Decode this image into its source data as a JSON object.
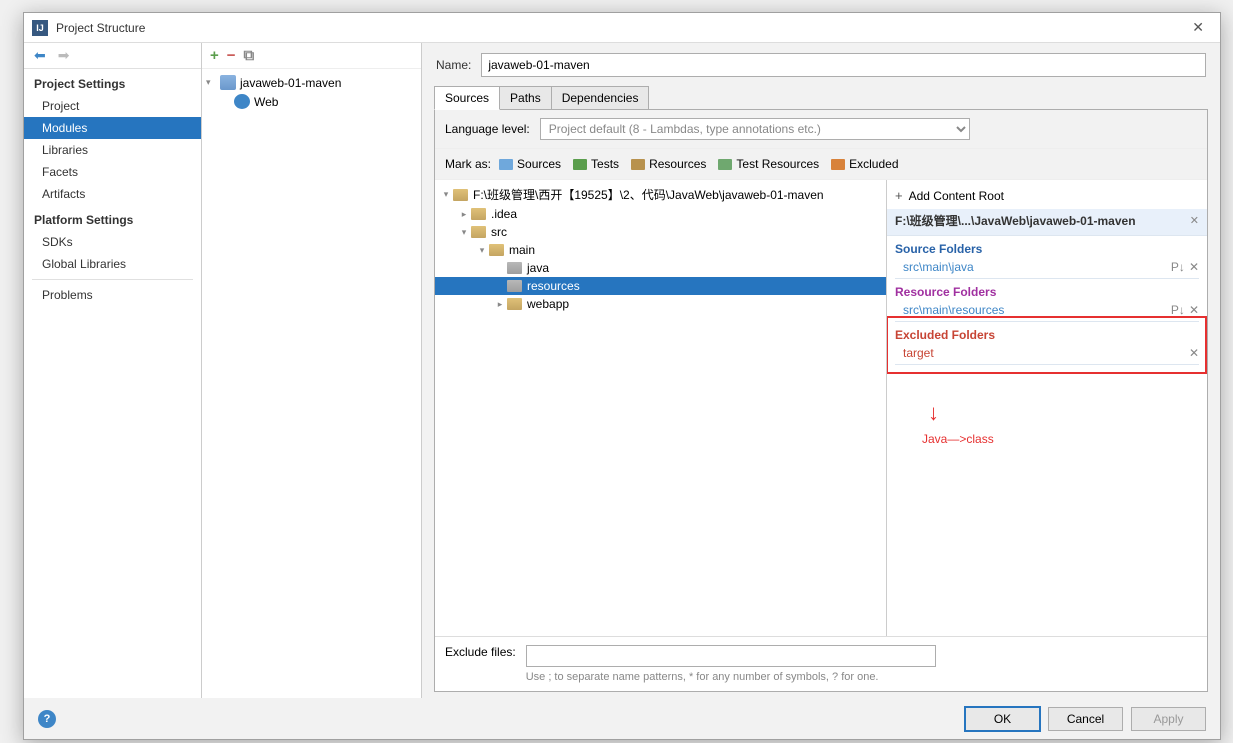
{
  "title": "Project Structure",
  "sidebar": {
    "project_settings_hdr": "Project Settings",
    "items": [
      "Project",
      "Modules",
      "Libraries",
      "Facets",
      "Artifacts"
    ],
    "platform_settings_hdr": "Platform Settings",
    "platform_items": [
      "SDKs",
      "Global Libraries"
    ],
    "problems": "Problems"
  },
  "modules": {
    "root": "javaweb-01-maven",
    "child": "Web"
  },
  "name_label": "Name:",
  "name_value": "javaweb-01-maven",
  "tabs": [
    "Sources",
    "Paths",
    "Dependencies"
  ],
  "lang_label": "Language level:",
  "lang_value": "Project default (8 - Lambdas, type annotations etc.)",
  "mark_as": "Mark as:",
  "marks": {
    "sources": "Sources",
    "tests": "Tests",
    "resources": "Resources",
    "test_resources": "Test Resources",
    "excluded": "Excluded"
  },
  "mark_colors": {
    "sources": "#6fa8dc",
    "tests": "#5b9e4d",
    "resources": "#b8924e",
    "test_resources": "#6fa86f",
    "excluded": "#d8823a"
  },
  "file_tree": {
    "root": "F:\\班级管理\\西开【19525】\\2、代码\\JavaWeb\\javaweb-01-maven",
    "idea": ".idea",
    "src": "src",
    "main": "main",
    "java": "java",
    "resources": "resources",
    "webapp": "webapp"
  },
  "side": {
    "add_content": "Add Content Root",
    "root_path": "F:\\班级管理\\...\\JavaWeb\\javaweb-01-maven",
    "source_folders": "Source Folders",
    "src_java": "src\\main\\java",
    "resource_folders": "Resource Folders",
    "src_resources": "src\\main\\resources",
    "excluded_folders": "Excluded Folders",
    "target": "target"
  },
  "annotation": "Java—>class",
  "exclude_label": "Exclude files:",
  "exclude_hint": "Use ; to separate name patterns, * for any number of symbols, ? for one.",
  "buttons": {
    "ok": "OK",
    "cancel": "Cancel",
    "apply": "Apply"
  },
  "watermark": ""
}
